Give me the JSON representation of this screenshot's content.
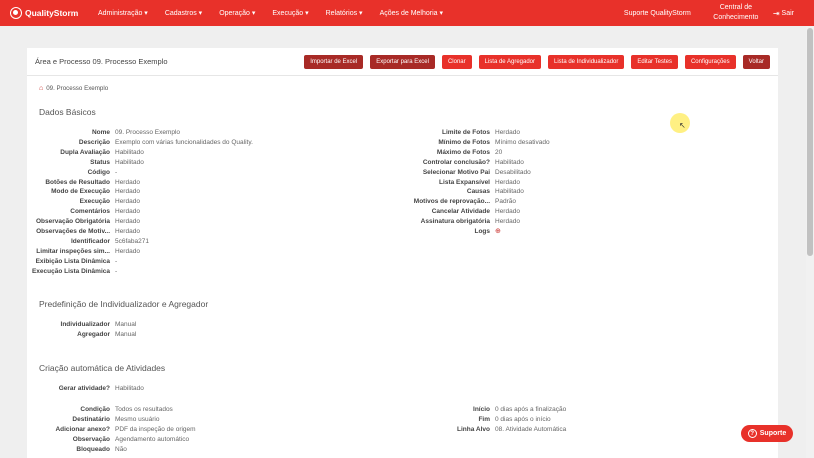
{
  "nav": {
    "brand": "QualityStorm",
    "menu": [
      {
        "label": "Administração ▾"
      },
      {
        "label": "Cadastros ▾"
      },
      {
        "label": "Operação ▾"
      },
      {
        "label": "Execução ▾"
      },
      {
        "label": "Relatórios ▾"
      },
      {
        "label": "Ações de Melhoria ▾"
      }
    ],
    "support": "Suporte QualityStorm",
    "central_line1": "Central de",
    "central_line2": "Conhecimento",
    "logout": "Sair"
  },
  "panel": {
    "title": "Área e Processo 09. Processo Exemplo",
    "buttons": [
      {
        "label": "Importar de Excel"
      },
      {
        "label": "Exportar para Excel"
      },
      {
        "label": "Clonar"
      },
      {
        "label": "Lista de Agregador"
      },
      {
        "label": "Lista de Individualizador"
      },
      {
        "label": "Editar Testes"
      },
      {
        "label": "Configurações"
      },
      {
        "label": "Voltar"
      }
    ]
  },
  "breadcrumb": "09. Processo Exemplo",
  "dados": {
    "title": "Dados Básicos",
    "left": [
      {
        "k": "Nome",
        "v": "09. Processo Exemplo"
      },
      {
        "k": "Descrição",
        "v": "Exemplo com várias funcionalidades do Quality."
      },
      {
        "k": "Dupla Avaliação",
        "v": "Habilitado"
      },
      {
        "k": "Status",
        "v": "Habilitado"
      },
      {
        "k": "Código",
        "v": "-"
      },
      {
        "k": "Botões de Resultado",
        "v": "Herdado"
      },
      {
        "k": "Modo de Execução",
        "v": "Herdado"
      },
      {
        "k": "Execução",
        "v": "Herdado"
      },
      {
        "k": "Comentários",
        "v": "Herdado"
      },
      {
        "k": "Observação Obrigatória",
        "v": "Herdado"
      },
      {
        "k": "Observações de Motiv...",
        "v": "Herdado"
      },
      {
        "k": "Identificador",
        "v": "5c6faba271"
      },
      {
        "k": "Limitar inspeções sim...",
        "v": "Herdado"
      },
      {
        "k": "Exibição Lista Dinâmica",
        "v": "-"
      },
      {
        "k": "Execução Lista Dinâmica",
        "v": "-"
      }
    ],
    "right": [
      {
        "k": "Limite de Fotos",
        "v": "Herdado"
      },
      {
        "k": "Mínimo de Fotos",
        "v": "Mínimo desativado"
      },
      {
        "k": "Máximo de Fotos",
        "v": "20"
      },
      {
        "k": "Controlar conclusão?",
        "v": "Habilitado"
      },
      {
        "k": "Selecionar Motivo Pai",
        "v": "Desabilitado"
      },
      {
        "k": "Lista Expansível",
        "v": "Herdado"
      },
      {
        "k": "Causas",
        "v": "Habilitado"
      },
      {
        "k": "Motivos de reprovação...",
        "v": "Padrão"
      },
      {
        "k": "Cancelar Atividade",
        "v": "Herdado"
      },
      {
        "k": "Assinatura obrigatória",
        "v": "Herdado"
      },
      {
        "k": "Logs",
        "v": ""
      }
    ]
  },
  "predef": {
    "title": "Predefinição de Individualizador e Agregador",
    "rows": [
      {
        "k": "Individualizador",
        "v": "Manual"
      },
      {
        "k": "Agregador",
        "v": "Manual"
      }
    ]
  },
  "criacao": {
    "title": "Criação automática de Atividades",
    "gerar": {
      "k": "Gerar atividade?",
      "v": "Habilitado"
    },
    "left": [
      {
        "k": "Condição",
        "v": "Todos os resultados"
      },
      {
        "k": "Destinatário",
        "v": "Mesmo usuário"
      },
      {
        "k": "Adicionar anexo?",
        "v": "PDF da inspeção de origem"
      },
      {
        "k": "Observação",
        "v": "Agendamento automático"
      },
      {
        "k": "Bloqueado",
        "v": "Não"
      }
    ],
    "right": [
      {
        "k": "Início",
        "v": "0 dias após a finalização"
      },
      {
        "k": "Fim",
        "v": "0 dias após o início"
      },
      {
        "k": "Linha Alvo",
        "v": "08. Atividade Automática"
      }
    ]
  },
  "support_bubble": "Suporte",
  "icons": {
    "home": "home-icon",
    "logs": "search-plus-icon",
    "logout": "sign-out-icon"
  },
  "colors": {
    "primary": "#e8312a",
    "button_dark": "#a82a26"
  }
}
